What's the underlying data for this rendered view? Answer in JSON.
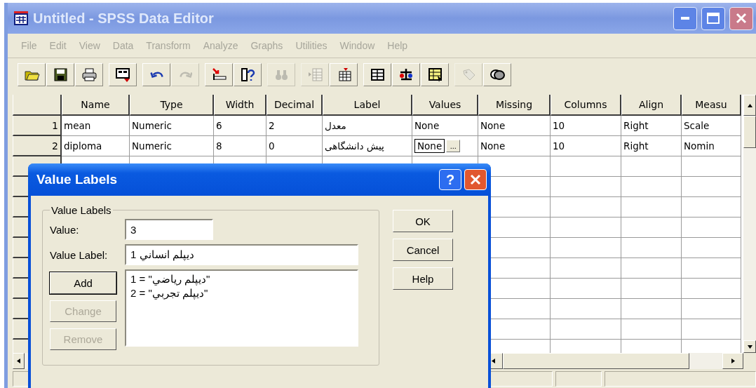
{
  "window": {
    "title": "Untitled - SPSS Data Editor",
    "active": false
  },
  "menu": [
    {
      "label": "File",
      "disabled": true
    },
    {
      "label": "Edit",
      "disabled": true
    },
    {
      "label": "View",
      "disabled": true
    },
    {
      "label": "Data",
      "disabled": true
    },
    {
      "label": "Transform",
      "disabled": true
    },
    {
      "label": "Analyze",
      "disabled": true
    },
    {
      "label": "Graphs",
      "disabled": true
    },
    {
      "label": "Utilities",
      "disabled": true
    },
    {
      "label": "Window",
      "disabled": true
    },
    {
      "label": "Help",
      "disabled": true
    }
  ],
  "toolbar": [
    [
      {
        "disabled": false
      },
      {
        "disabled": false
      },
      {
        "disabled": false
      }
    ],
    [
      {
        "disabled": false
      }
    ],
    [
      {
        "disabled": false
      },
      {
        "disabled": true
      }
    ],
    [
      {
        "disabled": false
      },
      {
        "disabled": false
      }
    ],
    [
      {
        "disabled": true
      }
    ],
    [
      {
        "disabled": true
      },
      {
        "disabled": false
      }
    ],
    [
      {
        "disabled": false
      },
      {
        "disabled": false
      },
      {
        "disabled": false
      }
    ],
    [
      {
        "disabled": true
      },
      {
        "disabled": false
      }
    ]
  ],
  "table": {
    "columns": [
      "Name",
      "Type",
      "Width",
      "Decimal",
      "Label",
      "Values",
      "Missing",
      "Columns",
      "Align",
      "Measu"
    ],
    "rows": [
      {
        "number": "1",
        "cells": [
          {
            "text": "mean",
            "selected": false
          },
          {
            "text": "Numeric",
            "selected": false
          },
          {
            "text": "6",
            "selected": false
          },
          {
            "text": "2",
            "selected": false
          },
          {
            "text": "معدل",
            "selected": false
          },
          {
            "text": "None",
            "selected": false
          },
          {
            "text": "None",
            "selected": false
          },
          {
            "text": "10",
            "selected": false
          },
          {
            "text": "Right",
            "selected": false
          },
          {
            "text": "Scale",
            "selected": false
          }
        ]
      },
      {
        "number": "2",
        "cells": [
          {
            "text": "diploma",
            "selected": false
          },
          {
            "text": "Numeric",
            "selected": false
          },
          {
            "text": "8",
            "selected": false
          },
          {
            "text": "0",
            "selected": false
          },
          {
            "text": "پیش دانشگاهی",
            "selected": false
          },
          {
            "text": "None",
            "selected": true
          },
          {
            "text": "None",
            "selected": false
          },
          {
            "text": "10",
            "selected": false
          },
          {
            "text": "Right",
            "selected": false
          },
          {
            "text": "Nomin",
            "selected": false
          }
        ]
      }
    ],
    "cell_button": "..."
  },
  "dialog": {
    "title": "Value Labels",
    "help_button": "?",
    "group_title": "Value Labels",
    "value": {
      "label": "Value:",
      "value": "3"
    },
    "value_label": {
      "label": "Value Label:",
      "value": "دیپلم انساني 1"
    },
    "buttons": [
      {
        "label": "Add",
        "disabled": false
      },
      {
        "label": "Change",
        "disabled": true
      },
      {
        "label": "Remove",
        "disabled": true
      }
    ],
    "list": [
      "1 = \"دیپلم ریاضي\"",
      "2 = \"دیپلم تجربي\""
    ],
    "side_buttons": [
      "OK",
      "Cancel",
      "Help"
    ]
  }
}
